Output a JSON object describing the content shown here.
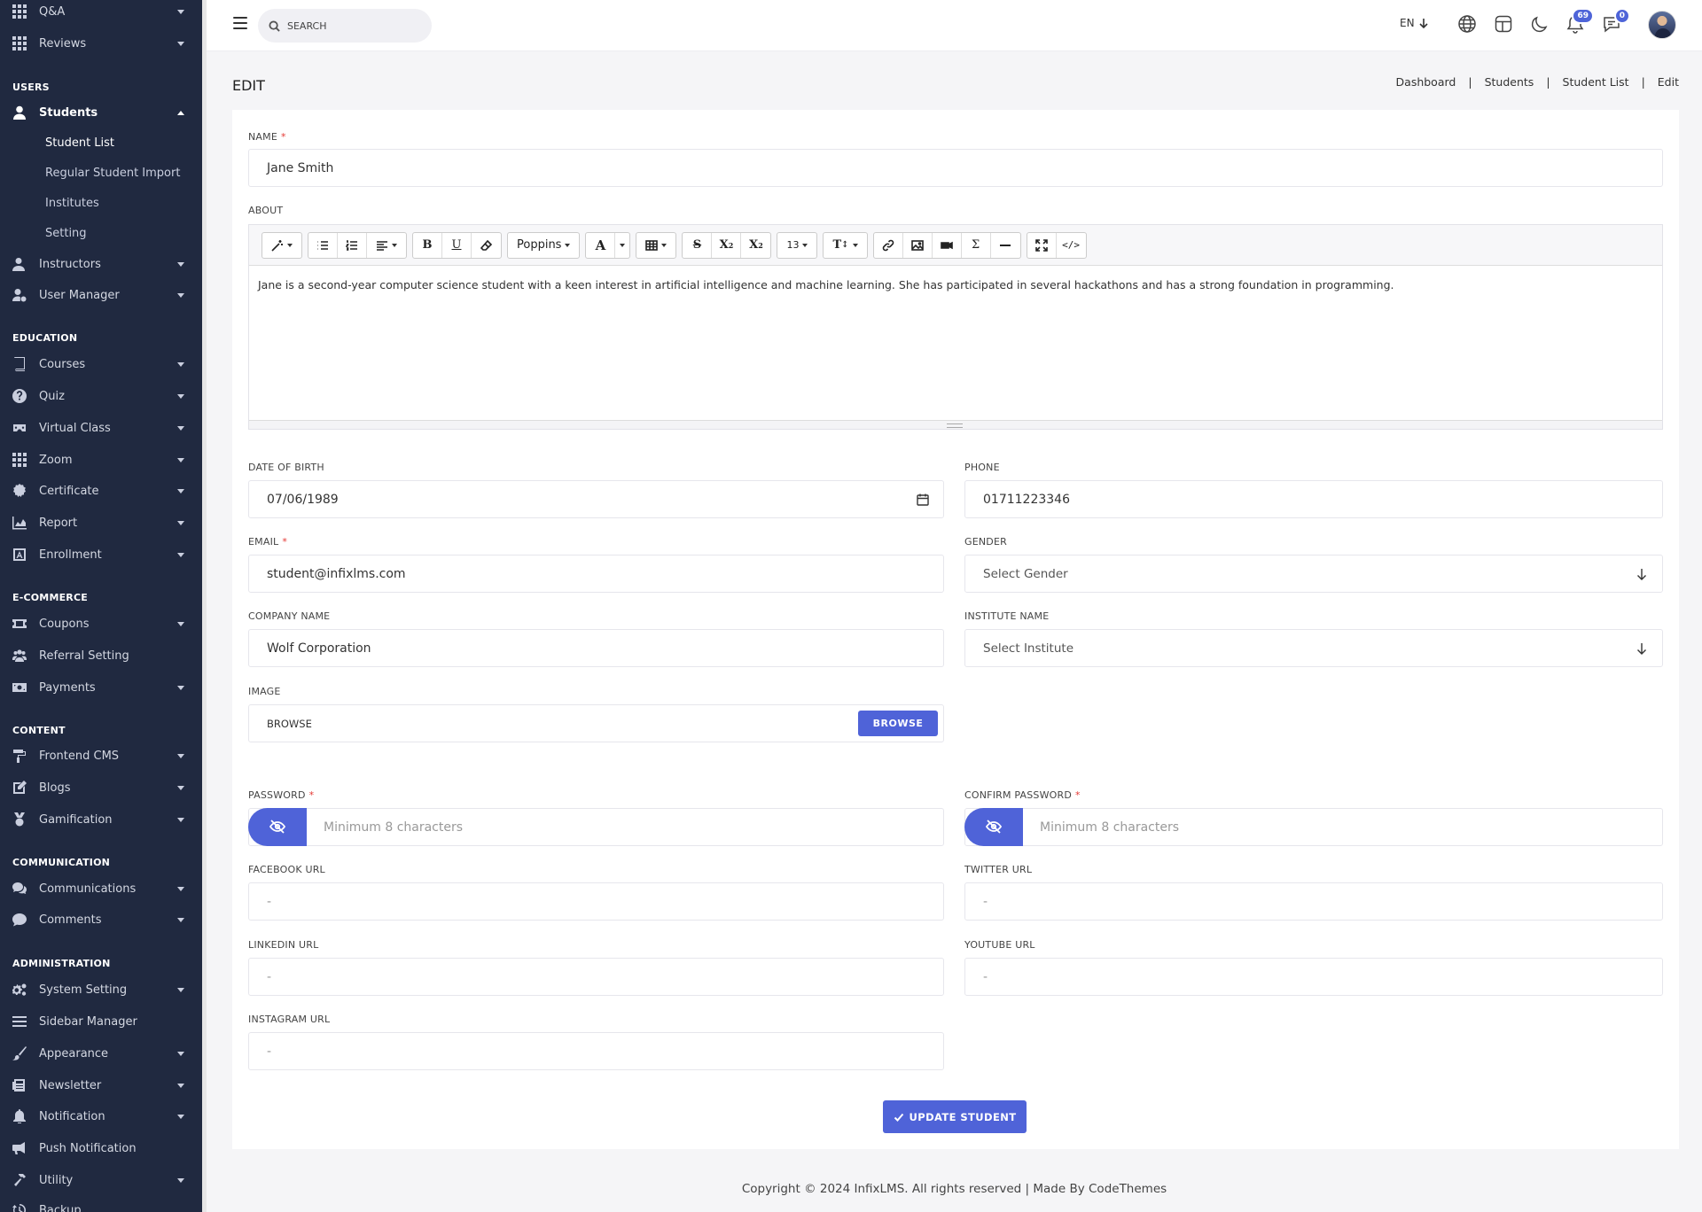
{
  "sidebar": {
    "sections": {
      "users": "USERS",
      "education": "EDUCATION",
      "ecommerce": "E-COMMERCE",
      "content": "CONTENT",
      "communication": "COMMUNICATION",
      "administration": "ADMINISTRATION"
    },
    "items": {
      "qa": "Q&A",
      "reviews": "Reviews",
      "students": "Students",
      "instructors": "Instructors",
      "user_manager": "User Manager",
      "courses": "Courses",
      "quiz": "Quiz",
      "virtual_class": "Virtual Class",
      "zoom": "Zoom",
      "certificate": "Certificate",
      "report": "Report",
      "enrollment": "Enrollment",
      "coupons": "Coupons",
      "referral_setting": "Referral Setting",
      "payments": "Payments",
      "frontend_cms": "Frontend CMS",
      "blogs": "Blogs",
      "gamification": "Gamification",
      "communications": "Communications",
      "comments": "Comments",
      "system_setting": "System Setting",
      "sidebar_manager": "Sidebar Manager",
      "appearance": "Appearance",
      "newsletter": "Newsletter",
      "notification": "Notification",
      "push_notification": "Push Notification",
      "utility": "Utility",
      "backup": "Backup"
    },
    "students_sub": {
      "student_list": "Student List",
      "regular_student_import": "Regular Student Import",
      "institutes": "Institutes",
      "setting": "Setting"
    }
  },
  "topbar": {
    "search_placeholder": "SEARCH",
    "language": "EN",
    "notifications_count": "69",
    "messages_count": "0"
  },
  "page": {
    "title": "EDIT",
    "breadcrumb": [
      "Dashboard",
      "Students",
      "Student List",
      "Edit"
    ]
  },
  "form": {
    "name": {
      "label": "NAME",
      "value": "Jane Smith"
    },
    "about": {
      "label": "ABOUT",
      "font": "Poppins",
      "font_size": "13",
      "text": "Jane is a second-year computer science student with a keen interest in artificial intelligence and machine learning. She has participated in several hackathons and has a strong foundation in programming."
    },
    "dob": {
      "label": "DATE OF BIRTH",
      "value": "07/06/1989"
    },
    "phone": {
      "label": "PHONE",
      "value": "01711223346"
    },
    "email": {
      "label": "EMAIL",
      "value": "student@infixlms.com"
    },
    "gender": {
      "label": "GENDER",
      "value": "Select Gender"
    },
    "company": {
      "label": "COMPANY NAME",
      "value": "Wolf Corporation"
    },
    "institute": {
      "label": "INSTITUTE NAME",
      "value": "Select Institute"
    },
    "image": {
      "label": "IMAGE",
      "value": "BROWSE",
      "button": "BROWSE"
    },
    "password": {
      "label": "PASSWORD",
      "placeholder": "Minimum 8 characters"
    },
    "confirm_password": {
      "label": "CONFIRM PASSWORD",
      "placeholder": "Minimum 8 characters"
    },
    "facebook": {
      "label": "FACEBOOK URL",
      "value": "-"
    },
    "twitter": {
      "label": "TWITTER URL",
      "value": "-"
    },
    "linkedin": {
      "label": "LINKEDIN URL",
      "value": "-"
    },
    "youtube": {
      "label": "YOUTUBE URL",
      "value": "-"
    },
    "instagram": {
      "label": "INSTAGRAM URL",
      "value": "-"
    },
    "submit": "UPDATE STUDENT"
  },
  "footer": {
    "text": "Copyright © 2024 InfixLMS. All rights reserved | Made By CodeThemes"
  },
  "colors": {
    "sidebar_bg": "#202940",
    "accent": "#4f63d8",
    "required": "#e53935"
  }
}
